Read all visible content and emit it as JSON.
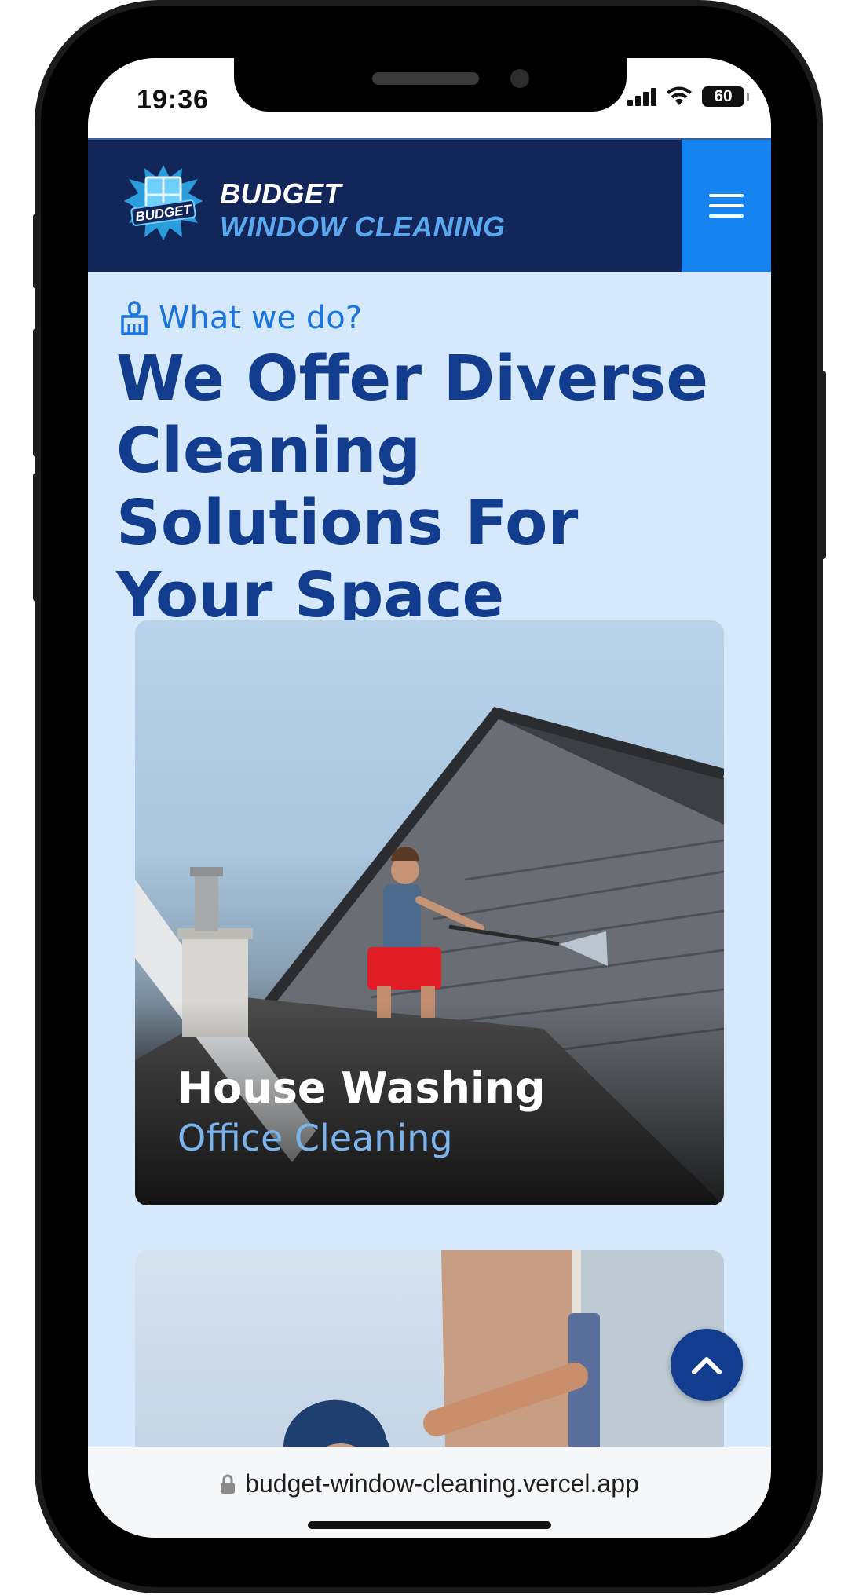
{
  "status_bar": {
    "time": "19:36",
    "battery": "60",
    "icons": [
      "signal-icon",
      "wifi-icon",
      "battery-icon"
    ]
  },
  "header": {
    "logo_text": "BUDGET",
    "brand_line1": "BUDGET",
    "brand_line2": "WINDOW CLEANING",
    "menu_icon": "hamburger-menu-icon"
  },
  "section": {
    "eyebrow": "What we do?",
    "eyebrow_icon": "broom-icon",
    "title": "We Offer Diverse Cleaning Solutions For Your Space"
  },
  "services": [
    {
      "title": "House Washing",
      "subtitle": "Office Cleaning"
    }
  ],
  "scroll_top_icon": "chevron-up-icon",
  "browser": {
    "url": "budget-window-cleaning.vercel.app",
    "lock_icon": "lock-icon"
  },
  "colors": {
    "header_bg": "#13265a",
    "menu_bg": "#1584f0",
    "page_bg": "#d6e8fb",
    "heading": "#123c8e",
    "accent": "#1a74de"
  }
}
